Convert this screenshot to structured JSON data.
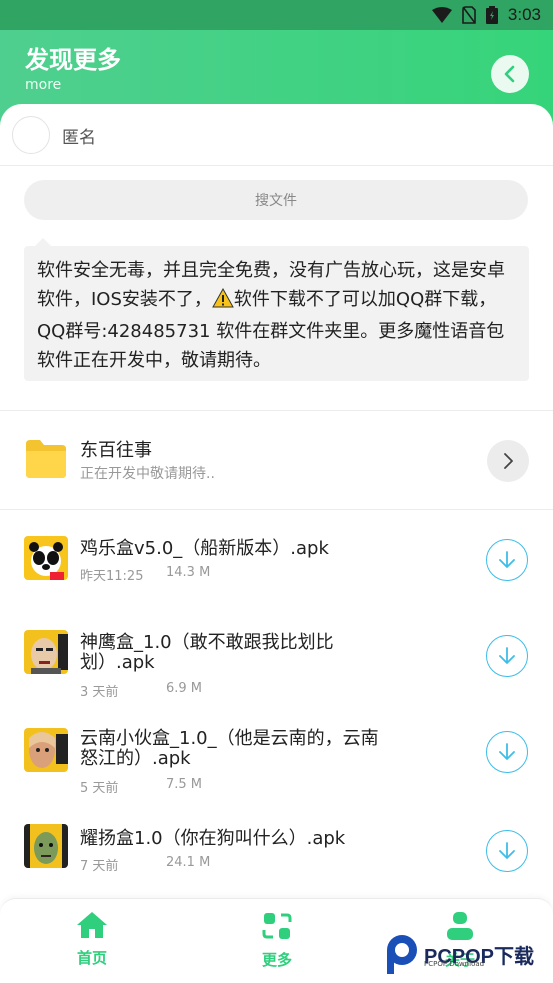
{
  "status_bar": {
    "time": "3:03"
  },
  "header": {
    "title": "发现更多",
    "subtitle": "more"
  },
  "user": {
    "name": "匿名"
  },
  "search": {
    "label": "搜文件"
  },
  "notice": {
    "text_before_icon": "软件安全无毒，并且完全免费，没有广告放心玩，这是安卓软件，IOS安装不了，",
    "text_after_icon": "软件下载不了可以加QQ群下载，QQ群号:428485731 软件在群文件夹里。更多魔性语音包软件正在开发中，敬请期待。"
  },
  "folder": {
    "name": "东百往事",
    "subtitle": "正在开发中敬请期待.."
  },
  "files": [
    {
      "name": "鸡乐盒v5.0_（船新版本）.apk",
      "date": "昨天11:25",
      "size": "14.3 M"
    },
    {
      "name": "神鹰盒_1.0（敢不敢跟我比划比划）.apk",
      "date": "3 天前",
      "size": "6.9 M"
    },
    {
      "name": "云南小伙盒_1.0_（他是云南的，云南怒江的）.apk",
      "date": "5 天前",
      "size": "7.5 M"
    },
    {
      "name": "耀扬盒1.0（你在狗叫什么）.apk",
      "date": "7 天前",
      "size": "24.1 M"
    }
  ],
  "nav": {
    "home": "首页",
    "more": "更多",
    "profile": "关于"
  },
  "watermark": {
    "brand": "PCPOP下载",
    "small": "PCPOP Download"
  },
  "colors": {
    "accent": "#2fcf7d",
    "download": "#3dbde8"
  }
}
